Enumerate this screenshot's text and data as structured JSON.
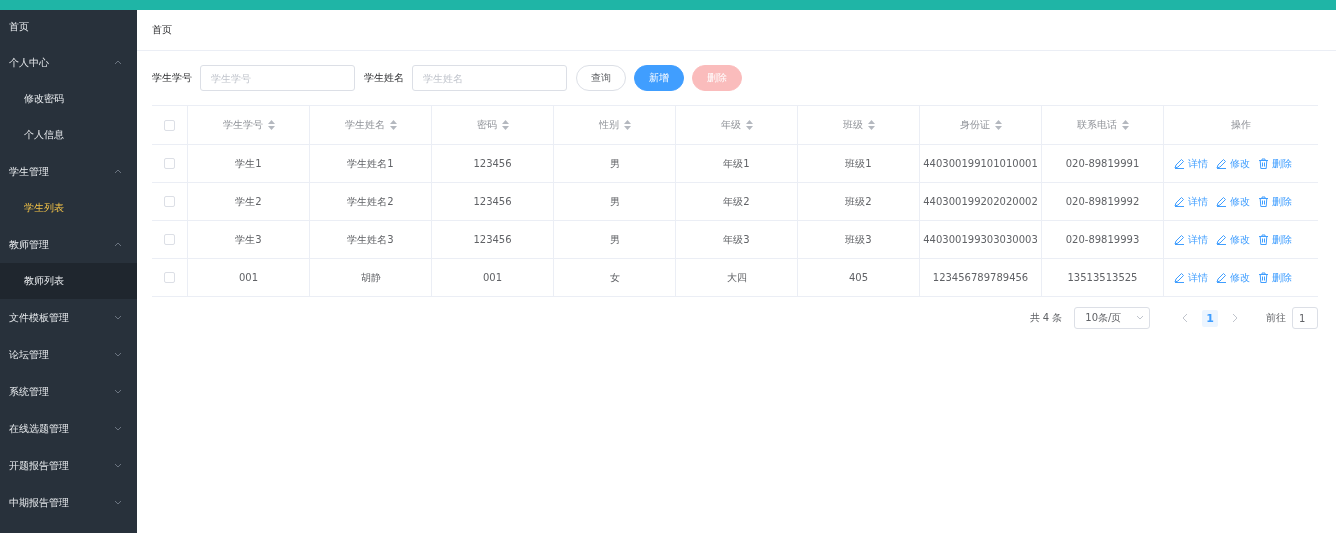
{
  "sidebar": {
    "items": [
      {
        "label": "首页"
      },
      {
        "label": "个人中心",
        "expanded": true,
        "children": [
          {
            "label": "修改密码",
            "selected": false,
            "hovered": false
          },
          {
            "label": "个人信息",
            "selected": false,
            "hovered": false
          }
        ]
      },
      {
        "label": "学生管理",
        "expanded": true,
        "children": [
          {
            "label": "学生列表",
            "selected": true,
            "hovered": false
          }
        ]
      },
      {
        "label": "教师管理",
        "expanded": true,
        "children": [
          {
            "label": "教师列表",
            "selected": false,
            "hovered": true
          }
        ]
      },
      {
        "label": "文件模板管理",
        "expanded": false
      },
      {
        "label": "论坛管理",
        "expanded": false
      },
      {
        "label": "系统管理",
        "expanded": false
      },
      {
        "label": "在线选题管理",
        "expanded": false
      },
      {
        "label": "开题报告管理",
        "expanded": false
      },
      {
        "label": "中期报告管理",
        "expanded": false
      }
    ]
  },
  "breadcrumb": [
    "首页"
  ],
  "search": {
    "fields": [
      {
        "label": "学生学号",
        "placeholder": "学生学号"
      },
      {
        "label": "学生姓名",
        "placeholder": "学生姓名"
      }
    ],
    "buttons": [
      {
        "label": "查询",
        "kind": "plain",
        "disabled": false
      },
      {
        "label": "新增",
        "kind": "primary",
        "disabled": false
      },
      {
        "label": "删除",
        "kind": "danger",
        "disabled": true
      }
    ]
  },
  "table": {
    "columns": [
      {
        "label": "学生学号",
        "sortable": true
      },
      {
        "label": "学生姓名",
        "sortable": true
      },
      {
        "label": "密码",
        "sortable": true
      },
      {
        "label": "性别",
        "sortable": true
      },
      {
        "label": "年级",
        "sortable": true
      },
      {
        "label": "班级",
        "sortable": true
      },
      {
        "label": "身份证",
        "sortable": true
      },
      {
        "label": "联系电话",
        "sortable": true
      },
      {
        "label": "操作",
        "sortable": false
      }
    ],
    "header_checked": false,
    "rows": [
      {
        "checked": false,
        "cells": [
          "学生1",
          "学生姓名1",
          "123456",
          "男",
          "年级1",
          "班级1",
          "440300199101010001",
          "020-89819991"
        ],
        "actions": [
          {
            "label": "详情",
            "kind": "edit"
          },
          {
            "label": "修改",
            "kind": "edit"
          },
          {
            "label": "删除",
            "kind": "delete"
          }
        ]
      },
      {
        "checked": false,
        "cells": [
          "学生2",
          "学生姓名2",
          "123456",
          "男",
          "年级2",
          "班级2",
          "440300199202020002",
          "020-89819992"
        ],
        "actions": [
          {
            "label": "详情",
            "kind": "edit"
          },
          {
            "label": "修改",
            "kind": "edit"
          },
          {
            "label": "删除",
            "kind": "delete"
          }
        ]
      },
      {
        "checked": false,
        "cells": [
          "学生3",
          "学生姓名3",
          "123456",
          "男",
          "年级3",
          "班级3",
          "440300199303030003",
          "020-89819993"
        ],
        "actions": [
          {
            "label": "详情",
            "kind": "edit"
          },
          {
            "label": "修改",
            "kind": "edit"
          },
          {
            "label": "删除",
            "kind": "delete"
          }
        ]
      },
      {
        "checked": false,
        "cells": [
          "001",
          "胡静",
          "001",
          "女",
          "大四",
          "405",
          "123456789789456",
          "13513513525"
        ],
        "actions": [
          {
            "label": "详情",
            "kind": "edit"
          },
          {
            "label": "修改",
            "kind": "edit"
          },
          {
            "label": "删除",
            "kind": "delete"
          }
        ]
      }
    ]
  },
  "pagination": {
    "total": "共 4 条",
    "page_size": "10条/页",
    "pages": [
      {
        "label": "1",
        "selected": true
      }
    ],
    "goto_label": "前往",
    "goto_value": "1"
  }
}
